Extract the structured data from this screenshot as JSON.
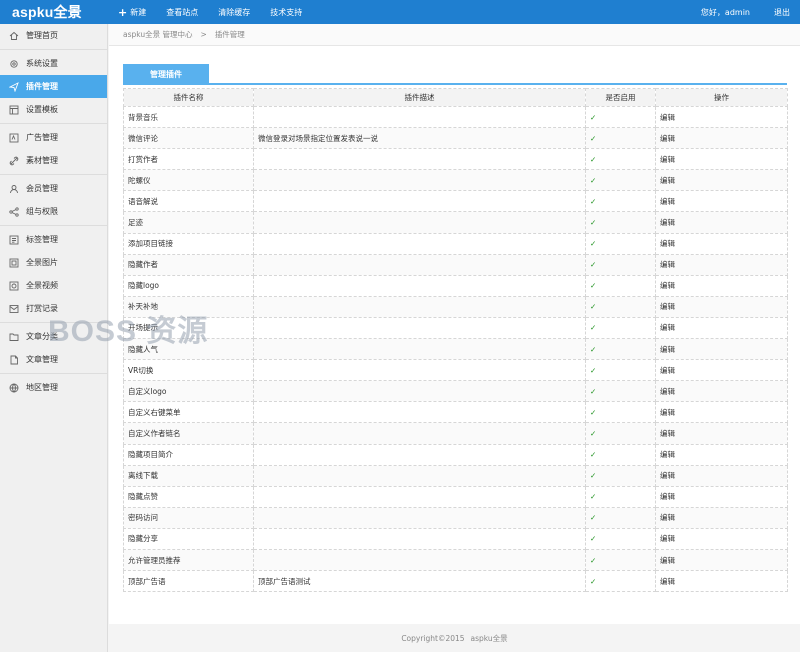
{
  "brand": {
    "logo": "aspku全景"
  },
  "topnav": [
    {
      "label": "新建",
      "icon": "plus-icon"
    },
    {
      "label": "查看站点"
    },
    {
      "label": "清除缓存"
    },
    {
      "label": "技术支持"
    }
  ],
  "user": {
    "greeting": "您好，admin",
    "logout": "退出"
  },
  "sidebar": {
    "items": [
      {
        "label": "管理首页",
        "icon": "home-icon"
      },
      {
        "label": "系统设置",
        "icon": "gear-icon"
      },
      {
        "label": "插件管理",
        "icon": "send-icon",
        "active": true
      },
      {
        "label": "设置模板",
        "icon": "template-icon"
      },
      {
        "label": "广告管理",
        "icon": "ad-icon"
      },
      {
        "label": "素材管理",
        "icon": "link-icon"
      },
      {
        "label": "会员管理",
        "icon": "users-icon"
      },
      {
        "label": "组与权限",
        "icon": "share-icon"
      },
      {
        "label": "标签管理",
        "icon": "tag-icon"
      },
      {
        "label": "全景图片",
        "icon": "image-icon"
      },
      {
        "label": "全景视频",
        "icon": "video-icon"
      },
      {
        "label": "打赏记录",
        "icon": "mail-icon"
      },
      {
        "label": "文章分类",
        "icon": "folder-icon"
      },
      {
        "label": "文章管理",
        "icon": "document-icon"
      },
      {
        "label": "地区管理",
        "icon": "globe-icon"
      }
    ]
  },
  "breadcrumb": {
    "root": "aspku全景 管理中心",
    "separator": ">",
    "current": "插件管理"
  },
  "tab": {
    "label": "管理插件"
  },
  "table": {
    "headers": [
      "插件名称",
      "插件描述",
      "是否启用",
      "操作"
    ],
    "rows": [
      {
        "name": "背景音乐",
        "desc": "",
        "enabled": "✓",
        "action": "编辑"
      },
      {
        "name": "微信评论",
        "desc": "微信登录对场景指定位置发表说一说",
        "enabled": "✓",
        "action": "编辑"
      },
      {
        "name": "打赏作者",
        "desc": "",
        "enabled": "✓",
        "action": "编辑"
      },
      {
        "name": "陀螺仪",
        "desc": "",
        "enabled": "✓",
        "action": "编辑"
      },
      {
        "name": "语音解说",
        "desc": "",
        "enabled": "✓",
        "action": "编辑"
      },
      {
        "name": "足迹",
        "desc": "",
        "enabled": "✓",
        "action": "编辑"
      },
      {
        "name": "添加项目链接",
        "desc": "",
        "enabled": "✓",
        "action": "编辑"
      },
      {
        "name": "隐藏作者",
        "desc": "",
        "enabled": "✓",
        "action": "编辑"
      },
      {
        "name": "隐藏logo",
        "desc": "",
        "enabled": "✓",
        "action": "编辑"
      },
      {
        "name": "补天补地",
        "desc": "",
        "enabled": "✓",
        "action": "编辑"
      },
      {
        "name": "开场提示",
        "desc": "",
        "enabled": "✓",
        "action": "编辑"
      },
      {
        "name": "隐藏人气",
        "desc": "",
        "enabled": "✓",
        "action": "编辑"
      },
      {
        "name": "VR切换",
        "desc": "",
        "enabled": "✓",
        "action": "编辑"
      },
      {
        "name": "自定义logo",
        "desc": "",
        "enabled": "✓",
        "action": "编辑"
      },
      {
        "name": "自定义右键菜单",
        "desc": "",
        "enabled": "✓",
        "action": "编辑"
      },
      {
        "name": "自定义作者链名",
        "desc": "",
        "enabled": "✓",
        "action": "编辑"
      },
      {
        "name": "隐藏项目简介",
        "desc": "",
        "enabled": "✓",
        "action": "编辑"
      },
      {
        "name": "离线下载",
        "desc": "",
        "enabled": "✓",
        "action": "编辑"
      },
      {
        "name": "隐藏点赞",
        "desc": "",
        "enabled": "✓",
        "action": "编辑"
      },
      {
        "name": "密码访问",
        "desc": "",
        "enabled": "✓",
        "action": "编辑"
      },
      {
        "name": "隐藏分享",
        "desc": "",
        "enabled": "✓",
        "action": "编辑"
      },
      {
        "name": "允许管理员推荐",
        "desc": "",
        "enabled": "✓",
        "action": "编辑"
      },
      {
        "name": "顶部广告语",
        "desc": "顶部广告语测试",
        "enabled": "✓",
        "action": "编辑"
      }
    ]
  },
  "footer": {
    "copyright": "Copyright©2015",
    "site": "aspku全景"
  },
  "watermark": "BOSS 资源",
  "colors": {
    "topbar": "#1f7fd0",
    "active": "#49a8ea",
    "check": "#1a8f1a"
  }
}
